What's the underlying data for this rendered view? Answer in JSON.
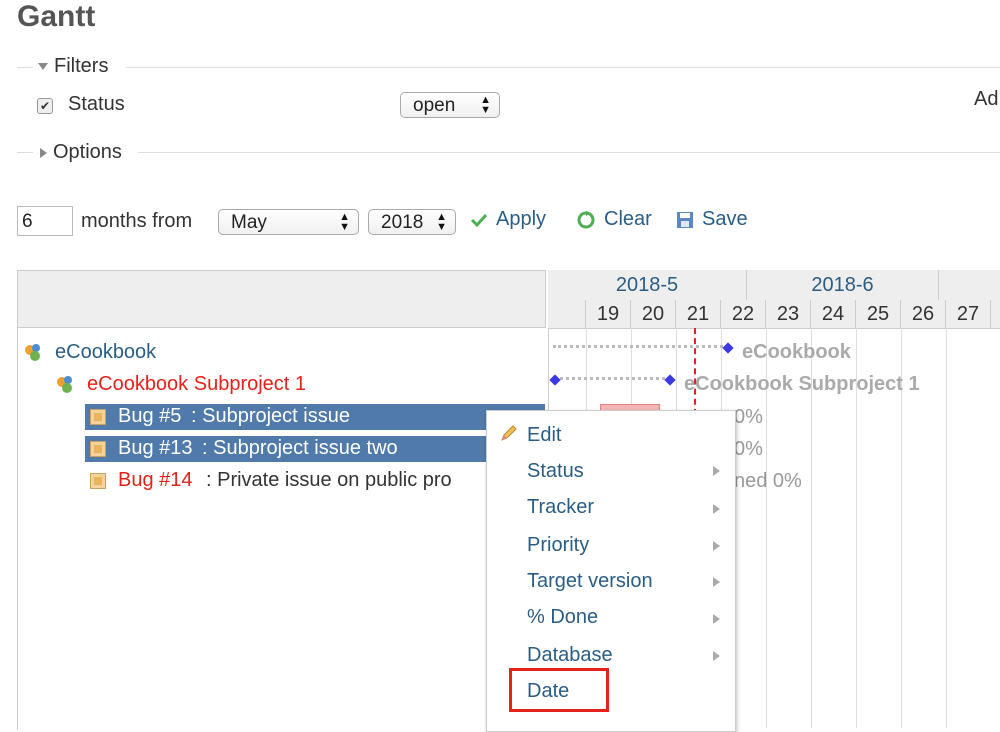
{
  "page": {
    "title": "Gantt"
  },
  "filters": {
    "legend": "Filters",
    "status_label": "Status",
    "status_value": "open",
    "add_filter_partial": "Ad"
  },
  "options": {
    "legend": "Options"
  },
  "toolbar": {
    "months_value": "6",
    "months_from_label": "months from",
    "month_select": "May",
    "year_select": "2018",
    "apply": "Apply",
    "clear": "Clear",
    "save": "Save"
  },
  "gantt": {
    "months": [
      "2018-5",
      "2018-6"
    ],
    "days": [
      "19",
      "20",
      "21",
      "22",
      "23",
      "24",
      "25",
      "26",
      "27"
    ],
    "rows": [
      {
        "text": "eCookbook",
        "type": "project",
        "color": "#2a5d84"
      },
      {
        "text": "eCookbook Subproject 1",
        "type": "subproject",
        "color": "#e3221b"
      },
      {
        "tracker_id": "Bug #5",
        "subject": ": Subproject issue",
        "selected": true
      },
      {
        "tracker_id": "Bug #13",
        "subject": ": Subproject issue two",
        "selected": true
      },
      {
        "tracker_id": "Bug #14",
        "subject": ": Private issue on public pro",
        "selected": false
      }
    ],
    "bar_labels": {
      "project": "eCookbook",
      "subproject": "eCookbook Subproject 1",
      "bug5_percent": "0%",
      "bug13_percent": "0%",
      "bug14_status": "ned 0%"
    }
  },
  "context_menu": {
    "items": [
      {
        "label": "Edit",
        "submenu": false
      },
      {
        "label": "Status",
        "submenu": true
      },
      {
        "label": "Tracker",
        "submenu": true
      },
      {
        "label": "Priority",
        "submenu": true
      },
      {
        "label": "Target version",
        "submenu": true
      },
      {
        "label": "% Done",
        "submenu": true
      },
      {
        "label": "Database",
        "submenu": true
      },
      {
        "label": "Date",
        "submenu": false
      }
    ]
  },
  "colors": {
    "link": "#2a5d84",
    "selection": "#507aaa",
    "highlight_box": "#e3221b",
    "today_line": "#e3221b"
  }
}
